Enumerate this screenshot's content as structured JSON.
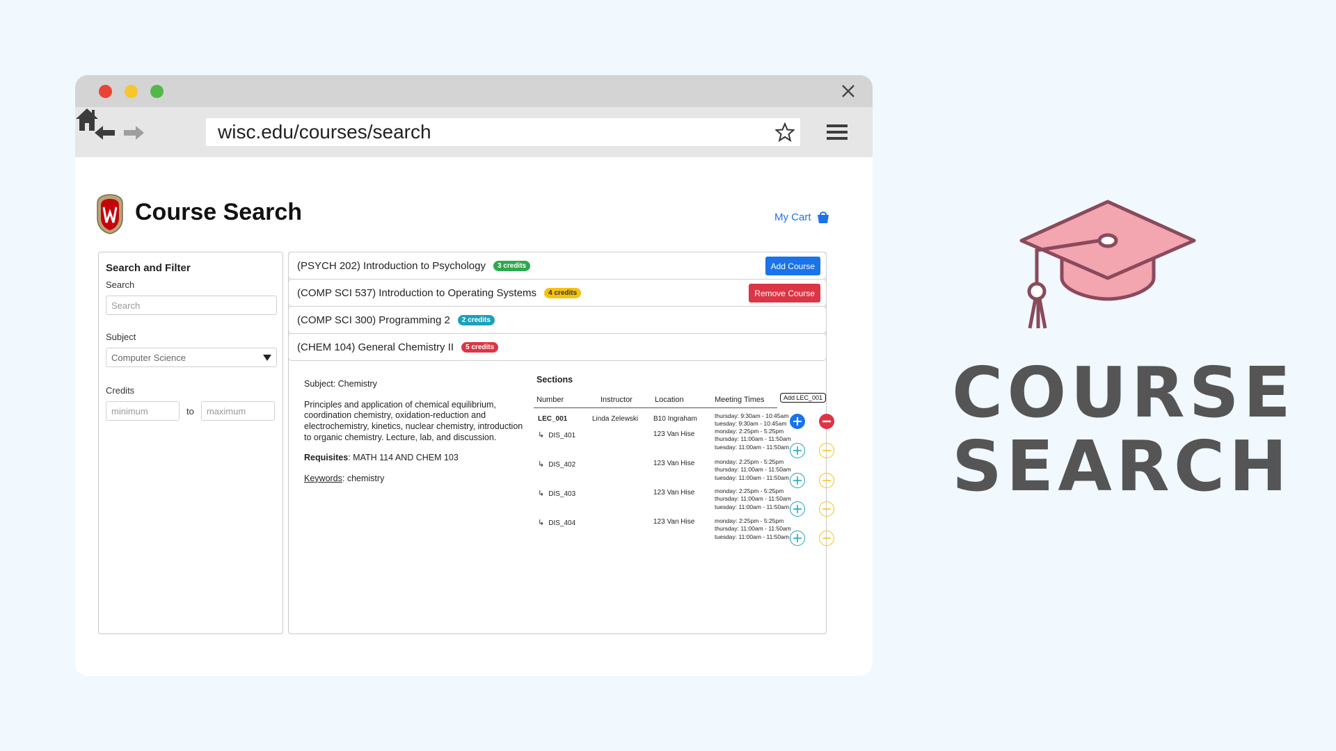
{
  "browser": {
    "url": "wisc.edu/courses/search",
    "icons": [
      "back-arrow-icon",
      "forward-arrow-icon",
      "home-icon",
      "star-icon",
      "hamburger-menu-icon",
      "close-icon"
    ]
  },
  "header": {
    "title": "Course Search",
    "cart_label": "My Cart"
  },
  "filter": {
    "heading": "Search and Filter",
    "search_label": "Search",
    "search_placeholder": "Search",
    "subject_label": "Subject",
    "subject_value": "Computer Science",
    "credits_label": "Credits",
    "min_placeholder": "minimum",
    "to_label": "to",
    "max_placeholder": "maximum"
  },
  "courses": [
    {
      "name": "(PSYCH 202) Introduction to Psychology",
      "credits": "3 credits",
      "color": "#2fa84f",
      "action": "Add Course"
    },
    {
      "name": "(COMP SCI 537) Introduction to Operating Systems",
      "credits": "4 credits",
      "color": "#f6c20e",
      "action": "Remove Course"
    },
    {
      "name": "(COMP SCI 300) Programming 2",
      "credits": "2 credits",
      "color": "#1aa1bd",
      "action": ""
    },
    {
      "name": "(CHEM 104) General Chemistry II",
      "credits": "5 credits",
      "color": "#dc3545",
      "action": ""
    }
  ],
  "detail": {
    "subject": "Subject: Chemistry",
    "description": "Principles and application of chemical equilibrium, coordination chemistry, oxidation-reduction and electrochemistry, kinetics, nuclear chemistry, introduction to organic chemistry. Lecture, lab, and discussion.",
    "requisites_label": "Requisites",
    "requisites_value": ": MATH 114 AND CHEM 103",
    "keywords_label": "Keywords",
    "keywords_value": ": chemistry"
  },
  "sections": {
    "heading": "Sections",
    "columns": [
      "Number",
      "Instructor",
      "Location",
      "Meeting Times"
    ],
    "tooltip": "Add LEC_001",
    "rows": [
      {
        "arrow": "",
        "number": "LEC_001",
        "instructor": "Linda Zelewski",
        "location": "B10 Ingraham",
        "times": [
          "thursday: 9:30am - 10:45am",
          "tuesday: 9:30am - 10:45am"
        ]
      },
      {
        "arrow": "↳",
        "number": "DIS_401",
        "instructor": "",
        "location": "123 Van Hise",
        "times": [
          "monday: 2:25pm - 5:25pm",
          "thursday: 11:00am - 11:50am",
          "tuesday: 11:00am - 11:50am"
        ]
      },
      {
        "arrow": "↳",
        "number": "DIS_402",
        "instructor": "",
        "location": "123 Van Hise",
        "times": [
          "monday: 2:25pm - 5:25pm",
          "thursday: 11:00am - 11:50am",
          "tuesday: 11:00am - 11:50am"
        ]
      },
      {
        "arrow": "↳",
        "number": "DIS_403",
        "instructor": "",
        "location": "123 Van Hise",
        "times": [
          "monday: 2:25pm - 5:25pm",
          "thursday: 11:00am - 11:50am",
          "tuesday: 11:00am - 11:50am"
        ]
      },
      {
        "arrow": "↳",
        "number": "DIS_404",
        "instructor": "",
        "location": "123 Van Hise",
        "times": [
          "monday: 2:25pm - 5:25pm",
          "thursday: 11:00am - 11:50am",
          "tuesday: 11:00am - 11:50am"
        ]
      }
    ]
  },
  "branding": {
    "line1": "COURSE",
    "line2": "SEARCH",
    "cap_color": "#f3a5b0",
    "cap_stroke": "#8a4a5c"
  }
}
